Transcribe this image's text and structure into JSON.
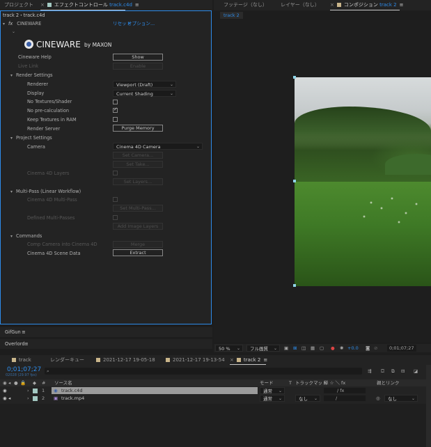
{
  "left_tabs": {
    "project": "プロジェクト",
    "effect_controls": "エフェクトコントロール",
    "effect_controls_target": "track.c4d",
    "menu_icon": "hamburger-icon"
  },
  "breadcrumb": "track 2・track.c4d",
  "effect": {
    "fx_badge": "fx",
    "name": "CINEWARE",
    "reset": "リセット",
    "about": "オプション...",
    "logo_main": "CINEWARE",
    "logo_by": "by MAXON",
    "cineware_help_label": "Cineware Help",
    "show_button": "Show",
    "live_link_label": "Live Link",
    "enable_button": "Enable",
    "render_settings": "Render Settings",
    "renderer_label": "Renderer",
    "renderer_value": "Viewport (Draft)",
    "display_label": "Display",
    "display_value": "Current Shading",
    "no_textures_label": "No Textures/Shader",
    "no_precalc_label": "No pre-calculation",
    "keep_textures_label": "Keep Textures in RAM",
    "render_server_label": "Render Server",
    "purge_memory_button": "Purge Memory",
    "project_settings": "Project Settings",
    "camera_label": "Camera",
    "camera_value": "Cinema 4D Camera",
    "set_camera_button": "Set Camera...",
    "set_take_button": "Set Take...",
    "c4d_layers_label": "Cinema 4D Layers",
    "set_layers_button": "Set Layers...",
    "multipass": "Multi-Pass (Linear Workflow)",
    "c4d_multipass_label": "Cinema 4D Multi-Pass",
    "set_multipass_button": "Set Multi-Pass...",
    "defined_multipasses_label": "Defined Multi-Passes",
    "add_image_layers_button": "Add Image Layers",
    "commands": "Commands",
    "comp_camera_label": "Comp Camera into Cinema 4D",
    "merge_button": "Merge",
    "scene_data_label": "Cinema 4D Scene Data",
    "extract_button": "Extract"
  },
  "side_panels": {
    "gifgun": "GifGun",
    "overlord": "Overlord"
  },
  "right_tabs": {
    "footage": "フッテージ（なし）",
    "layer": "レイヤー（なし）",
    "composition": "コンポジション",
    "composition_target": "track 2",
    "subtab": "track 2"
  },
  "viewer": {
    "zoom": "50 %",
    "quality": "フル画質",
    "exposure": "+0.0",
    "timecode": "0;01;07;27"
  },
  "timeline_tabs": [
    {
      "label": "track"
    },
    {
      "label": "レンダーキュー"
    },
    {
      "label": "2021-12-17 19-05-18"
    },
    {
      "label": "2021-12-17 19-13-54"
    },
    {
      "label": "track 2"
    }
  ],
  "timeline": {
    "timecode": "0;01;07;27",
    "frame_info": "02028 (29.97 fps)",
    "search_placeholder": "",
    "col_number": "#",
    "col_source": "ソース名",
    "col_mode": "モード",
    "col_t": "T",
    "col_trackmatte": "トラックマット",
    "col_switches": "単 ☆ ＼ fx",
    "col_parent": "親とリンク",
    "layers": [
      {
        "num": "1",
        "name": "track.c4d",
        "mode": "通常",
        "matte": "",
        "parent": "",
        "color": "#a3c9c2",
        "selected": true
      },
      {
        "num": "2",
        "name": "track.mp4",
        "mode": "通常",
        "matte": "なし",
        "parent": "なし",
        "color": "#a3c9c2",
        "selected": false
      }
    ]
  },
  "colors": {
    "accent": "#2d8ceb",
    "panel": "#232323",
    "bg": "#1d1d1d"
  }
}
